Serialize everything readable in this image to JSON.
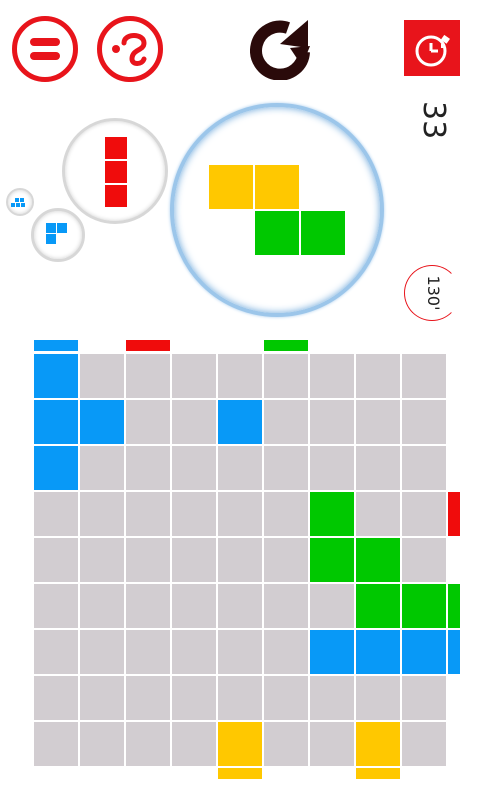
{
  "hud": {
    "pause_icon": "pause-icon",
    "help_icon": "question-icon",
    "restart_icon": "restart-icon",
    "timer_icon": "stopwatch-icon",
    "lines_count": "33",
    "speed_label": "130'"
  },
  "colors": {
    "empty": "#d2cdd1",
    "blue": "#0899f7",
    "red": "#f00c0c",
    "green": "#00c800",
    "yellow": "#ffc800",
    "accent": "#e8141b"
  },
  "board": {
    "rows": [
      [
        "blue",
        "empty",
        "empty",
        "empty",
        "empty",
        "empty",
        "empty",
        "empty",
        "empty"
      ],
      [
        "blue",
        "blue",
        "empty",
        "empty",
        "blue",
        "empty",
        "empty",
        "empty",
        "empty"
      ],
      [
        "blue",
        "empty",
        "empty",
        "empty",
        "empty",
        "empty",
        "empty",
        "empty",
        "empty"
      ],
      [
        "empty",
        "empty",
        "empty",
        "empty",
        "empty",
        "empty",
        "green",
        "empty",
        "empty"
      ],
      [
        "empty",
        "empty",
        "empty",
        "empty",
        "empty",
        "empty",
        "green",
        "green",
        "empty"
      ],
      [
        "empty",
        "empty",
        "empty",
        "empty",
        "empty",
        "empty",
        "empty",
        "green",
        "green"
      ],
      [
        "empty",
        "empty",
        "empty",
        "empty",
        "empty",
        "empty",
        "blue",
        "blue",
        "blue"
      ],
      [
        "empty",
        "empty",
        "empty",
        "empty",
        "empty",
        "empty",
        "empty",
        "empty",
        "empty"
      ],
      [
        "empty",
        "empty",
        "empty",
        "empty",
        "yellow",
        "empty",
        "empty",
        "yellow",
        "empty"
      ]
    ],
    "top_markers": [
      {
        "col": 0,
        "color": "blue"
      },
      {
        "col": 2,
        "color": "red"
      },
      {
        "col": 5,
        "color": "green"
      }
    ],
    "right_markers": [
      {
        "row": 3,
        "color": "red"
      },
      {
        "row": 5,
        "color": "green"
      },
      {
        "row": 6,
        "color": "blue"
      }
    ],
    "bottom_markers": [
      {
        "col": 4,
        "color": "yellow"
      },
      {
        "col": 7,
        "color": "yellow"
      }
    ]
  },
  "pieces": {
    "current": {
      "color": "yellow_green",
      "shape": "Z"
    },
    "next": {
      "color": "red",
      "shape": "I3"
    },
    "queue": [
      {
        "color": "blue",
        "shape": "L-small"
      },
      {
        "color": "blue",
        "shape": "L-mini"
      }
    ]
  }
}
